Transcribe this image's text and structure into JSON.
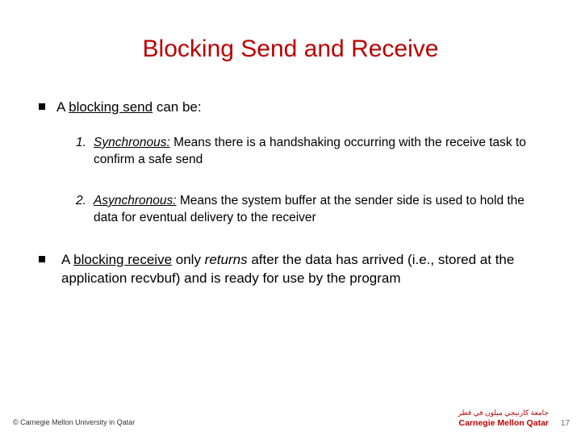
{
  "title": "Blocking Send and Receive",
  "bullets": {
    "b1_pre": "A ",
    "b1_key": "blocking send",
    "b1_post": " can be:",
    "n1_num": "1.",
    "n1_head": "Synchronous:",
    "n1_body": " Means there is a handshaking occurring with the receive task to confirm a safe send",
    "n2_num": "2.",
    "n2_head": "Asynchronous:",
    "n2_body": " Means the system buffer at the sender side is used to hold the data for eventual delivery to the receiver",
    "b2_pre": "A ",
    "b2_key": "blocking receive",
    "b2_mid1": " only ",
    "b2_ital": "returns",
    "b2_mid2": " after the data has arrived (i.e., stored at the application recvbuf) and is ready for use by the program"
  },
  "footer": {
    "copyright": "© Carnegie Mellon University in Qatar",
    "page": "17",
    "logo_arabic": "جامعة كارنيجي ميلون في قطر",
    "logo_en": "Carnegie Mellon Qatar"
  }
}
